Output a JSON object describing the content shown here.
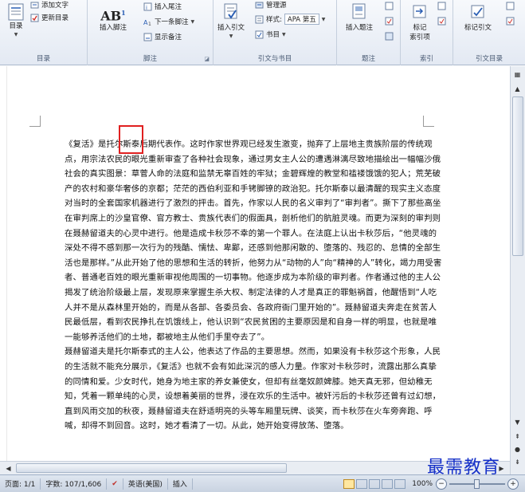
{
  "ribbon": {
    "toc": {
      "button": "目录",
      "add_text": "添加文字",
      "update": "更新目录",
      "group": "目录"
    },
    "footnotes": {
      "insert_footnote": "插入脚注",
      "insert_endnote": "插入尾注",
      "next_footnote": "下一条脚注",
      "show_notes": "显示备注",
      "group": "脚注",
      "ab_icon": "AB",
      "ab_sup": "1"
    },
    "citations": {
      "insert_citation": "插入引文",
      "manage_sources": "管理源",
      "style_label": "样式:",
      "style_value": "APA 第五",
      "bibliography": "书目",
      "group": "引文与书目"
    },
    "captions": {
      "insert_caption": "插入题注",
      "group": "题注"
    },
    "index": {
      "mark_entry": "标记",
      "mark_entry_2": "索引项",
      "group": "索引"
    },
    "toa": {
      "mark_citation": "标记引文",
      "group": "引文目录"
    }
  },
  "document": {
    "paragraphs": [
      "《复活》是托尔斯泰后期代表作。这时作家世界观已经发生激变，抛弃了上层地主贵族阶层的传统观点，用宗法农民的眼光重新审查了各种社会现象，通过男女主人公的遭遇淋漓尽致地描绘出一幅幅沙俄社会的真实图景：草菅人命的法庭和监禁无辜百姓的牢狱；金碧辉煌的教堂和褴褛饿饿的犯人；荒芜破产的农村和豪华奢侈的京都；茫茫的西伯利亚和手铐脚镣的政治犯。托尔斯泰以最清醒的现实主义态度对当时的全套国家机器进行了激烈的抨击。首先，作家以人民的名义审判了“审判者”。撕下了那些高坐在审判席上的沙皇官僚、官方教士、贵族代表们的假面具，剖析他们的肮脏灵魂。而更为深刻的审判则在聂赫留道夫的心灵中进行。他是造成卡秋莎不幸的第一个罪人。在法庭上认出卡秋莎后，“他灵魂的深处不得不感到那一次行为的残酷、懦怯、卑鄙，还感到他那闲散的、堕落的、残忍的、怠情的全部生活也是那样。”从此开始了他的思想和生活的转折，他努力从“动物的人”向“精神的人”转化，竭力用受害者、普通老百姓的眼光重新审视他周围的一切事物。他逐步成为本阶级的审判者。作者通过他的主人公揭发了统治阶级最上层，发现原来掌握生杀大权、制定法律的人才是真正的罪魁祸首，他醒悟到“人吃人并不是从森林里开始的，而是从各部、各委员会、各政府衙门里开始的”。聂赫留道夫奔走在贫苦人民最低层，看到农民挣扎在饥饿线上，他认识到“农民贫困的主要原因是和自身一样的明显，也就是唯一能够养活他们的土地，都被地主从他们手里夺去了”。",
      "聂赫留道夫是托尔斯泰式的主人公，他表达了作品的主要思想。然而，如果没有卡秋莎这个形象，人民的生活就不能充分展示，《复活》也就不会有如此深沉的感人力量。作家对卡秋莎时，流露出那么真挚的同情和爱。少女时代，她身为地主家的养女兼使女，但却有丝毫奴颜婢膝。她天真无邪，但幼稚无知，凭着一颗单纯的心灵，设想着美丽的世界，浸在欢乐的生活中。被奸污后的卡秋莎还曾有过幻想，直到风雨交加的秋夜，聂赫留道夫在舒适明亮的头等车厢里玩牌、谈笑，而卡秋莎在火车旁奔跑、呼喊，却得不到回音。这时，她才看清了一切。从此，她开始变得放荡、堕落。"
    ]
  },
  "status_bar": {
    "page": "页面: 1/1",
    "words": "字数: 107/1,606",
    "language": "英语(美国)",
    "mode": "插入",
    "zoom": "100%",
    "zoom_minus": "−",
    "zoom_plus": "+"
  },
  "watermark": "最需教育"
}
